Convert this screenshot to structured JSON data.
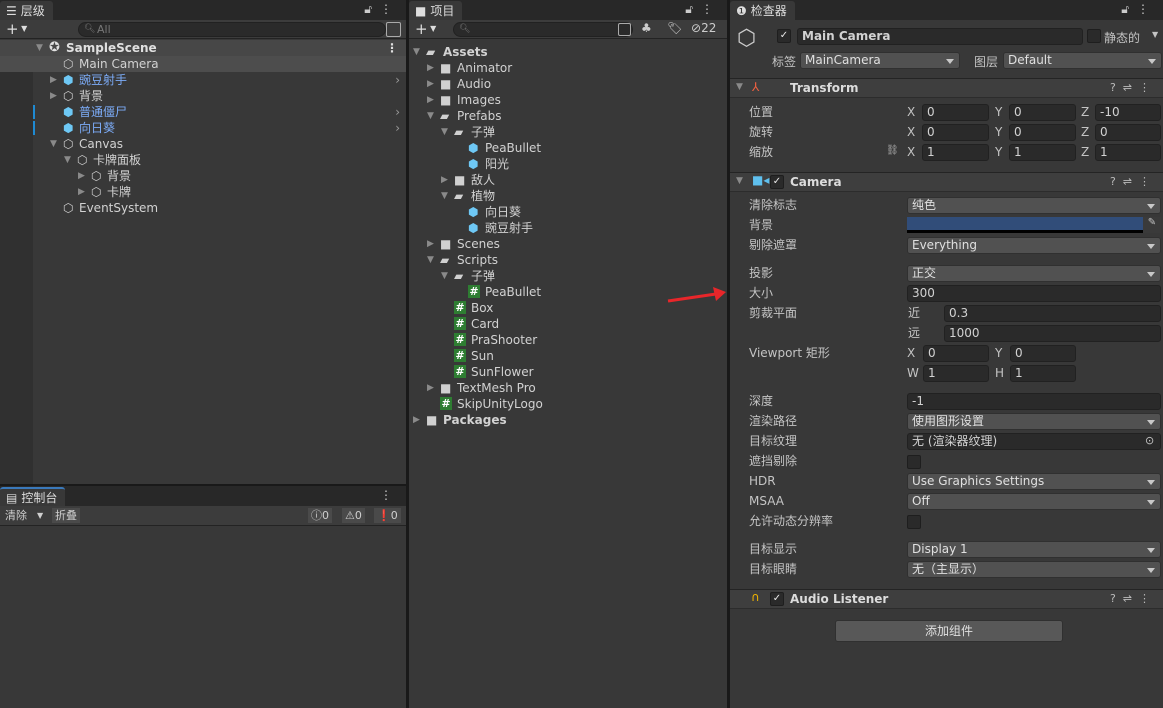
{
  "hierarchy": {
    "tab_label": "层级",
    "add_label": "+",
    "search_placeholder": "All",
    "scene": "SampleScene",
    "items": [
      {
        "label": "Main Camera",
        "depth": 1,
        "expander": "none",
        "prefab": false,
        "selected": true
      },
      {
        "label": "豌豆射手",
        "depth": 1,
        "expander": "closed",
        "prefab": true,
        "open_arrow": true
      },
      {
        "label": "背景",
        "depth": 1,
        "expander": "closed",
        "prefab": false
      },
      {
        "label": "普通僵尸",
        "depth": 1,
        "expander": "none",
        "prefab": true,
        "open_arrow": true,
        "marker": true
      },
      {
        "label": "向日葵",
        "depth": 1,
        "expander": "none",
        "prefab": true,
        "open_arrow": true,
        "marker": true
      },
      {
        "label": "Canvas",
        "depth": 1,
        "expander": "open",
        "prefab": false
      },
      {
        "label": "卡牌面板",
        "depth": 2,
        "expander": "open",
        "prefab": false
      },
      {
        "label": "背景",
        "depth": 3,
        "expander": "closed",
        "prefab": false
      },
      {
        "label": "卡牌",
        "depth": 3,
        "expander": "closed",
        "prefab": false
      },
      {
        "label": "EventSystem",
        "depth": 1,
        "expander": "none",
        "prefab": false
      }
    ]
  },
  "console": {
    "tab_label": "控制台",
    "clear_label": "清除",
    "collapse_label": "折叠",
    "log_count": "0",
    "warning_count": "0",
    "error_count": "0"
  },
  "project": {
    "tab_label": "项目",
    "add_label": "+",
    "hidden_count": "22",
    "items": [
      {
        "label": "Assets",
        "depth": 0,
        "type": "folder-open",
        "expander": "open",
        "bold": true
      },
      {
        "label": "Animator",
        "depth": 1,
        "type": "folder",
        "expander": "closed"
      },
      {
        "label": "Audio",
        "depth": 1,
        "type": "folder",
        "expander": "closed"
      },
      {
        "label": "Images",
        "depth": 1,
        "type": "folder",
        "expander": "closed"
      },
      {
        "label": "Prefabs",
        "depth": 1,
        "type": "folder-open",
        "expander": "open"
      },
      {
        "label": "子弹",
        "depth": 2,
        "type": "folder-open",
        "expander": "open"
      },
      {
        "label": "PeaBullet",
        "depth": 3,
        "type": "prefab",
        "expander": "none"
      },
      {
        "label": "阳光",
        "depth": 3,
        "type": "prefab",
        "expander": "none"
      },
      {
        "label": "敌人",
        "depth": 2,
        "type": "folder",
        "expander": "closed"
      },
      {
        "label": "植物",
        "depth": 2,
        "type": "folder-open",
        "expander": "open"
      },
      {
        "label": "向日葵",
        "depth": 3,
        "type": "prefab",
        "expander": "none"
      },
      {
        "label": "豌豆射手",
        "depth": 3,
        "type": "prefab",
        "expander": "none"
      },
      {
        "label": "Scenes",
        "depth": 1,
        "type": "folder",
        "expander": "closed"
      },
      {
        "label": "Scripts",
        "depth": 1,
        "type": "folder-open",
        "expander": "open"
      },
      {
        "label": "子弹",
        "depth": 2,
        "type": "folder-open",
        "expander": "open"
      },
      {
        "label": "PeaBullet",
        "depth": 3,
        "type": "script",
        "expander": "none"
      },
      {
        "label": "Box",
        "depth": 2,
        "type": "script",
        "expander": "none"
      },
      {
        "label": "Card",
        "depth": 2,
        "type": "script",
        "expander": "none"
      },
      {
        "label": "PraShooter",
        "depth": 2,
        "type": "script",
        "expander": "none"
      },
      {
        "label": "Sun",
        "depth": 2,
        "type": "script",
        "expander": "none"
      },
      {
        "label": "SunFlower",
        "depth": 2,
        "type": "script",
        "expander": "none"
      },
      {
        "label": "TextMesh Pro",
        "depth": 1,
        "type": "folder",
        "expander": "closed"
      },
      {
        "label": "SkipUnityLogo",
        "depth": 1,
        "type": "script",
        "expander": "none"
      },
      {
        "label": "Packages",
        "depth": 0,
        "type": "folder",
        "expander": "closed",
        "bold": true
      }
    ]
  },
  "inspector": {
    "tab_label": "检查器",
    "object_name": "Main Camera",
    "static_label": "静态的",
    "tag_label": "标签",
    "tag_value": "MainCamera",
    "layer_label": "图层",
    "layer_value": "Default",
    "transform": {
      "title": "Transform",
      "position_label": "位置",
      "position": {
        "x": "0",
        "y": "0",
        "z": "-10"
      },
      "rotation_label": "旋转",
      "rotation": {
        "x": "0",
        "y": "0",
        "z": "0"
      },
      "scale_label": "缩放",
      "scale": {
        "x": "1",
        "y": "1",
        "z": "1"
      }
    },
    "camera": {
      "title": "Camera",
      "clear_flags_label": "清除标志",
      "clear_flags": "纯色",
      "background_label": "背景",
      "background_color": "#314d79",
      "culling_mask_label": "剔除遮罩",
      "culling_mask": "Everything",
      "projection_label": "投影",
      "projection": "正交",
      "size_label": "大小",
      "size": "300",
      "clipping_label": "剪裁平面",
      "near_label": "近",
      "near": "0.3",
      "far_label": "远",
      "far": "1000",
      "viewport_label": "Viewport 矩形",
      "vx": "0",
      "vy": "0",
      "vw": "1",
      "vh": "1",
      "depth_label": "深度",
      "depth": "-1",
      "render_path_label": "渲染路径",
      "render_path": "使用图形设置",
      "target_texture_label": "目标纹理",
      "target_texture": "无 (渲染器纹理)",
      "occlusion_label": "遮挡剔除",
      "hdr_label": "HDR",
      "hdr": "Use Graphics Settings",
      "msaa_label": "MSAA",
      "msaa": "Off",
      "dynamic_res_label": "允许动态分辨率",
      "target_display_label": "目标显示",
      "target_display": "Display 1",
      "target_eye_label": "目标眼睛",
      "target_eye": "无（主显示）"
    },
    "audio_listener": {
      "title": "Audio Listener"
    },
    "add_component_label": "添加组件"
  },
  "colors": {
    "accent_blue": "#7cacf8",
    "prefab_blue": "#6ec8f5",
    "annotation_red": "#e8262a"
  }
}
